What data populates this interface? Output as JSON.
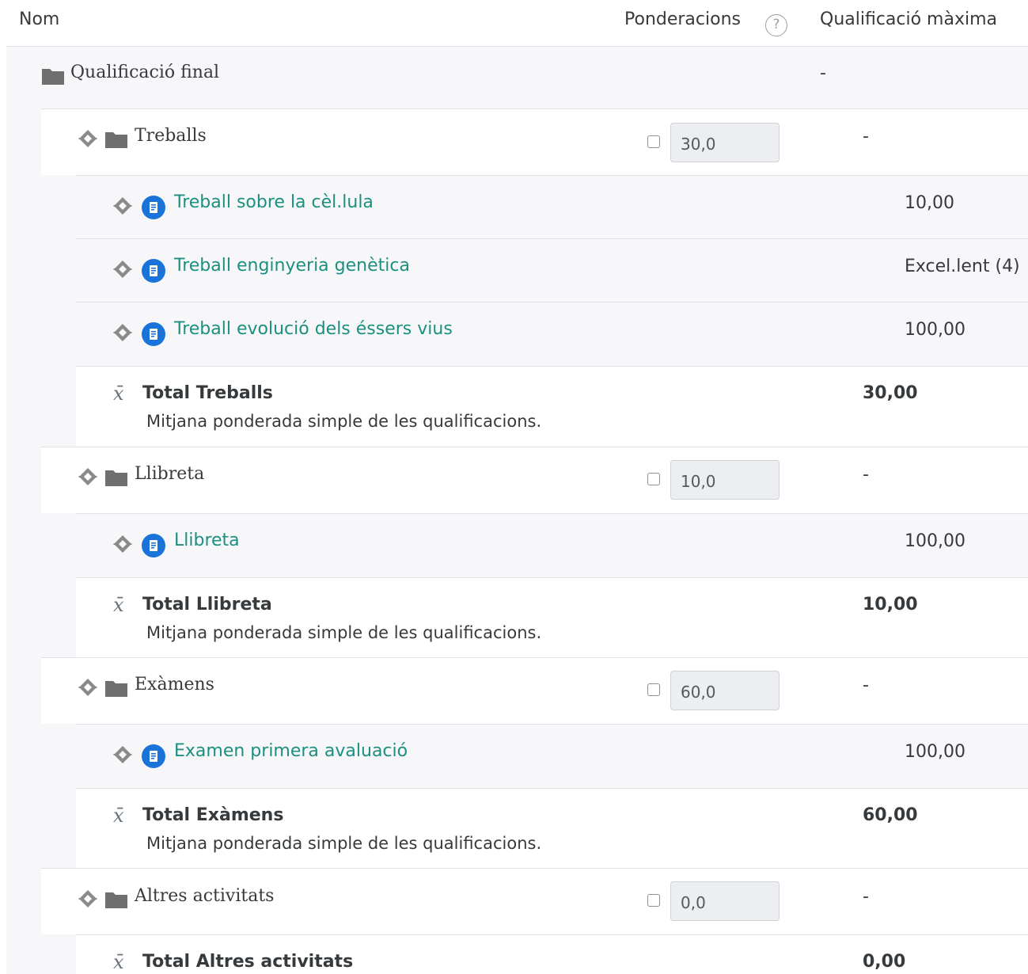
{
  "header": {
    "name": "Nom",
    "weights": "Ponderacions",
    "weights_help_icon": "?",
    "max_grade": "Qualificació màxima"
  },
  "course_total": {
    "label": "Qualificació final",
    "max": "-"
  },
  "categories": [
    {
      "label": "Treballs",
      "weight": "30,0",
      "max": "-",
      "items": [
        {
          "label": "Treball sobre la cèl.lula",
          "max": "10,00"
        },
        {
          "label": "Treball enginyeria genètica",
          "max": "Excel.lent (4)"
        },
        {
          "label": "Treball evolució dels éssers vius",
          "max": "100,00"
        }
      ],
      "total": {
        "label": "Total Treballs",
        "desc": "Mitjana ponderada simple de les qualificacions.",
        "max": "30,00"
      }
    },
    {
      "label": "Llibreta",
      "weight": "10,0",
      "max": "-",
      "items": [
        {
          "label": "Llibreta",
          "max": "100,00"
        }
      ],
      "total": {
        "label": "Total Llibreta",
        "desc": "Mitjana ponderada simple de les qualificacions.",
        "max": "10,00"
      }
    },
    {
      "label": "Exàmens",
      "weight": "60,0",
      "max": "-",
      "items": [
        {
          "label": "Examen primera avaluació",
          "max": "100,00"
        }
      ],
      "total": {
        "label": "Total Exàmens",
        "desc": "Mitjana ponderada simple de les qualificacions.",
        "max": "60,00"
      }
    },
    {
      "label": "Altres activitats",
      "weight": "0,0",
      "max": "-",
      "items": [],
      "total": {
        "label": "Total Altres activitats",
        "max": "0,00"
      }
    }
  ],
  "icons": {
    "move": "move-icon",
    "folder": "folder-icon",
    "assignment": "assignment-icon",
    "aggregation": "x̄"
  },
  "colors": {
    "link": "#1b8f80",
    "assignment_icon": "#1a73d9",
    "band": "#f7f7f9",
    "border": "#dee2e6"
  }
}
